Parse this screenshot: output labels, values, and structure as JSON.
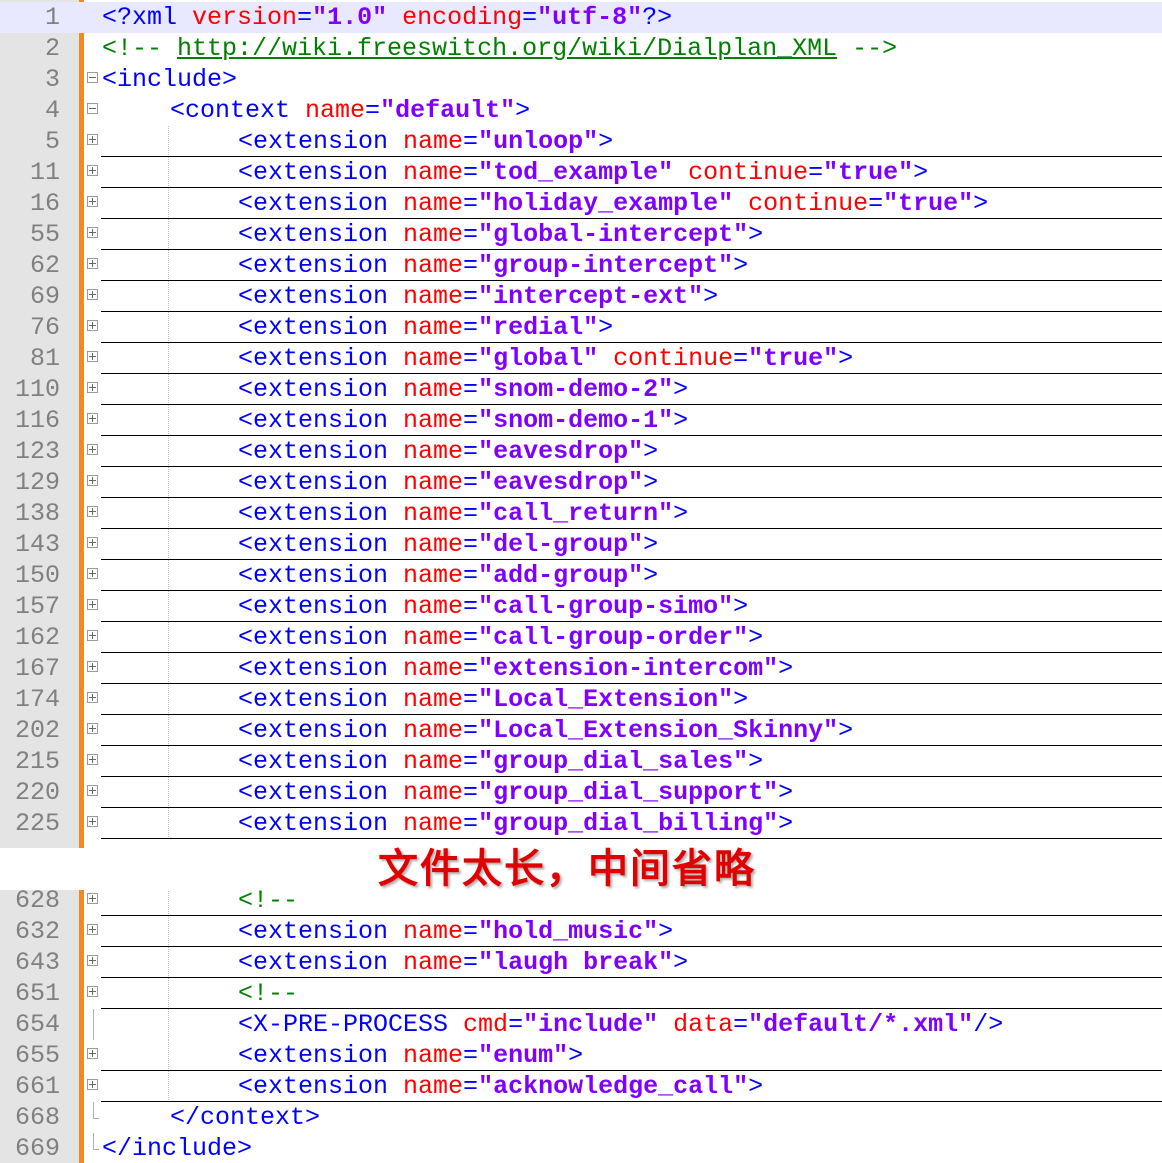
{
  "banner": "文件太长，中间省略",
  "top_lines": [
    {
      "n": "1",
      "fold": "",
      "hl": true,
      "indent": 0,
      "parts": [
        [
          "p",
          "<?"
        ],
        [
          "t",
          "xml "
        ],
        [
          "a",
          "version"
        ],
        [
          "t",
          "="
        ],
        [
          "v",
          "\"1.0\""
        ],
        [
          "a",
          " encoding"
        ],
        [
          "t",
          "="
        ],
        [
          "v",
          "\"utf-8\""
        ],
        [
          "p",
          "?>"
        ]
      ]
    },
    {
      "n": "2",
      "fold": "",
      "indent": 0,
      "parts": [
        [
          "c",
          "<!-- "
        ],
        [
          "u",
          "http://wiki.freeswitch.org/wiki/Dialplan_XML"
        ],
        [
          "c",
          " -->"
        ]
      ]
    },
    {
      "n": "3",
      "fold": "minus",
      "indent": 0,
      "parts": [
        [
          "t",
          "<include>"
        ]
      ]
    },
    {
      "n": "4",
      "fold": "minus",
      "indent": 1,
      "parts": [
        [
          "t",
          "<context "
        ],
        [
          "a",
          "name"
        ],
        [
          "t",
          "="
        ],
        [
          "v",
          "\"default\""
        ],
        [
          "t",
          ">"
        ]
      ]
    },
    {
      "n": "5",
      "fold": "plus",
      "sep": true,
      "indent": 2,
      "parts": [
        [
          "t",
          "<extension "
        ],
        [
          "a",
          "name"
        ],
        [
          "t",
          "="
        ],
        [
          "v",
          "\"unloop\""
        ],
        [
          "t",
          ">"
        ]
      ]
    },
    {
      "n": "11",
      "fold": "plus",
      "sep": true,
      "indent": 2,
      "parts": [
        [
          "t",
          "<extension "
        ],
        [
          "a",
          "name"
        ],
        [
          "t",
          "="
        ],
        [
          "v",
          "\"tod_example\""
        ],
        [
          "a",
          " continue"
        ],
        [
          "t",
          "="
        ],
        [
          "v",
          "\"true\""
        ],
        [
          "t",
          ">"
        ]
      ]
    },
    {
      "n": "16",
      "fold": "plus",
      "sep": true,
      "indent": 2,
      "parts": [
        [
          "t",
          "<extension "
        ],
        [
          "a",
          "name"
        ],
        [
          "t",
          "="
        ],
        [
          "v",
          "\"holiday_example\""
        ],
        [
          "a",
          " continue"
        ],
        [
          "t",
          "="
        ],
        [
          "v",
          "\"true\""
        ],
        [
          "t",
          ">"
        ]
      ]
    },
    {
      "n": "55",
      "fold": "plus",
      "sep": true,
      "indent": 2,
      "parts": [
        [
          "t",
          "<extension "
        ],
        [
          "a",
          "name"
        ],
        [
          "t",
          "="
        ],
        [
          "v",
          "\"global-intercept\""
        ],
        [
          "t",
          ">"
        ]
      ]
    },
    {
      "n": "62",
      "fold": "plus",
      "sep": true,
      "indent": 2,
      "parts": [
        [
          "t",
          "<extension "
        ],
        [
          "a",
          "name"
        ],
        [
          "t",
          "="
        ],
        [
          "v",
          "\"group-intercept\""
        ],
        [
          "t",
          ">"
        ]
      ]
    },
    {
      "n": "69",
      "fold": "plus",
      "sep": true,
      "indent": 2,
      "parts": [
        [
          "t",
          "<extension "
        ],
        [
          "a",
          "name"
        ],
        [
          "t",
          "="
        ],
        [
          "v",
          "\"intercept-ext\""
        ],
        [
          "t",
          ">"
        ]
      ]
    },
    {
      "n": "76",
      "fold": "plus",
      "sep": true,
      "indent": 2,
      "parts": [
        [
          "t",
          "<extension "
        ],
        [
          "a",
          "name"
        ],
        [
          "t",
          "="
        ],
        [
          "v",
          "\"redial\""
        ],
        [
          "t",
          ">"
        ]
      ]
    },
    {
      "n": "81",
      "fold": "plus",
      "sep": true,
      "indent": 2,
      "parts": [
        [
          "t",
          "<extension "
        ],
        [
          "a",
          "name"
        ],
        [
          "t",
          "="
        ],
        [
          "v",
          "\"global\""
        ],
        [
          "a",
          " continue"
        ],
        [
          "t",
          "="
        ],
        [
          "v",
          "\"true\""
        ],
        [
          "t",
          ">"
        ]
      ]
    },
    {
      "n": "110",
      "fold": "plus",
      "sep": true,
      "indent": 2,
      "parts": [
        [
          "t",
          "<extension "
        ],
        [
          "a",
          "name"
        ],
        [
          "t",
          "="
        ],
        [
          "v",
          "\"snom-demo-2\""
        ],
        [
          "t",
          ">"
        ]
      ]
    },
    {
      "n": "116",
      "fold": "plus",
      "sep": true,
      "indent": 2,
      "parts": [
        [
          "t",
          "<extension "
        ],
        [
          "a",
          "name"
        ],
        [
          "t",
          "="
        ],
        [
          "v",
          "\"snom-demo-1\""
        ],
        [
          "t",
          ">"
        ]
      ]
    },
    {
      "n": "123",
      "fold": "plus",
      "sep": true,
      "indent": 2,
      "parts": [
        [
          "t",
          "<extension "
        ],
        [
          "a",
          "name"
        ],
        [
          "t",
          "="
        ],
        [
          "v",
          "\"eavesdrop\""
        ],
        [
          "t",
          ">"
        ]
      ]
    },
    {
      "n": "129",
      "fold": "plus",
      "sep": true,
      "indent": 2,
      "parts": [
        [
          "t",
          "<extension "
        ],
        [
          "a",
          "name"
        ],
        [
          "t",
          "="
        ],
        [
          "v",
          "\"eavesdrop\""
        ],
        [
          "t",
          ">"
        ]
      ]
    },
    {
      "n": "138",
      "fold": "plus",
      "sep": true,
      "indent": 2,
      "parts": [
        [
          "t",
          "<extension "
        ],
        [
          "a",
          "name"
        ],
        [
          "t",
          "="
        ],
        [
          "v",
          "\"call_return\""
        ],
        [
          "t",
          ">"
        ]
      ]
    },
    {
      "n": "143",
      "fold": "plus",
      "sep": true,
      "indent": 2,
      "parts": [
        [
          "t",
          "<extension "
        ],
        [
          "a",
          "name"
        ],
        [
          "t",
          "="
        ],
        [
          "v",
          "\"del-group\""
        ],
        [
          "t",
          ">"
        ]
      ]
    },
    {
      "n": "150",
      "fold": "plus",
      "sep": true,
      "indent": 2,
      "parts": [
        [
          "t",
          "<extension "
        ],
        [
          "a",
          "name"
        ],
        [
          "t",
          "="
        ],
        [
          "v",
          "\"add-group\""
        ],
        [
          "t",
          ">"
        ]
      ]
    },
    {
      "n": "157",
      "fold": "plus",
      "sep": true,
      "indent": 2,
      "parts": [
        [
          "t",
          "<extension "
        ],
        [
          "a",
          "name"
        ],
        [
          "t",
          "="
        ],
        [
          "v",
          "\"call-group-simo\""
        ],
        [
          "t",
          ">"
        ]
      ]
    },
    {
      "n": "162",
      "fold": "plus",
      "sep": true,
      "indent": 2,
      "parts": [
        [
          "t",
          "<extension "
        ],
        [
          "a",
          "name"
        ],
        [
          "t",
          "="
        ],
        [
          "v",
          "\"call-group-order\""
        ],
        [
          "t",
          ">"
        ]
      ]
    },
    {
      "n": "167",
      "fold": "plus",
      "sep": true,
      "indent": 2,
      "parts": [
        [
          "t",
          "<extension "
        ],
        [
          "a",
          "name"
        ],
        [
          "t",
          "="
        ],
        [
          "v",
          "\"extension-intercom\""
        ],
        [
          "t",
          ">"
        ]
      ]
    },
    {
      "n": "174",
      "fold": "plus",
      "sep": true,
      "indent": 2,
      "parts": [
        [
          "t",
          "<extension "
        ],
        [
          "a",
          "name"
        ],
        [
          "t",
          "="
        ],
        [
          "v",
          "\"Local_Extension\""
        ],
        [
          "t",
          ">"
        ]
      ]
    },
    {
      "n": "202",
      "fold": "plus",
      "sep": true,
      "indent": 2,
      "parts": [
        [
          "t",
          "<extension "
        ],
        [
          "a",
          "name"
        ],
        [
          "t",
          "="
        ],
        [
          "v",
          "\"Local_Extension_Skinny\""
        ],
        [
          "t",
          ">"
        ]
      ]
    },
    {
      "n": "215",
      "fold": "plus",
      "sep": true,
      "indent": 2,
      "parts": [
        [
          "t",
          "<extension "
        ],
        [
          "a",
          "name"
        ],
        [
          "t",
          "="
        ],
        [
          "v",
          "\"group_dial_sales\""
        ],
        [
          "t",
          ">"
        ]
      ]
    },
    {
      "n": "220",
      "fold": "plus",
      "sep": true,
      "indent": 2,
      "parts": [
        [
          "t",
          "<extension "
        ],
        [
          "a",
          "name"
        ],
        [
          "t",
          "="
        ],
        [
          "v",
          "\"group_dial_support\""
        ],
        [
          "t",
          ">"
        ]
      ]
    },
    {
      "n": "225",
      "fold": "plus",
      "sep": true,
      "indent": 2,
      "parts": [
        [
          "t",
          "<extension "
        ],
        [
          "a",
          "name"
        ],
        [
          "t",
          "="
        ],
        [
          "v",
          "\"group_dial_billing\""
        ],
        [
          "t",
          ">"
        ]
      ]
    }
  ],
  "bottom_lines": [
    {
      "n": "628",
      "fold": "plus",
      "sep": true,
      "indent": 2,
      "parts": [
        [
          "c",
          "<!--"
        ]
      ]
    },
    {
      "n": "632",
      "fold": "plus",
      "sep": true,
      "indent": 2,
      "parts": [
        [
          "t",
          "<extension "
        ],
        [
          "a",
          "name"
        ],
        [
          "t",
          "="
        ],
        [
          "v",
          "\"hold_music\""
        ],
        [
          "t",
          ">"
        ]
      ]
    },
    {
      "n": "643",
      "fold": "plus",
      "sep": true,
      "indent": 2,
      "parts": [
        [
          "t",
          "<extension "
        ],
        [
          "a",
          "name"
        ],
        [
          "t",
          "="
        ],
        [
          "v",
          "\"laugh break\""
        ],
        [
          "t",
          ">"
        ]
      ]
    },
    {
      "n": "651",
      "fold": "plus",
      "sep": true,
      "indent": 2,
      "parts": [
        [
          "c",
          "<!--"
        ]
      ]
    },
    {
      "n": "654",
      "fold": "",
      "indent": 2,
      "parts": [
        [
          "t",
          "<X-PRE-PROCESS "
        ],
        [
          "a",
          "cmd"
        ],
        [
          "t",
          "="
        ],
        [
          "v",
          "\"include\""
        ],
        [
          "a",
          " data"
        ],
        [
          "t",
          "="
        ],
        [
          "v",
          "\"default/*.xml\""
        ],
        [
          "t",
          "/>"
        ]
      ]
    },
    {
      "n": "655",
      "fold": "plus",
      "sep": true,
      "indent": 2,
      "parts": [
        [
          "t",
          "<extension "
        ],
        [
          "a",
          "name"
        ],
        [
          "t",
          "="
        ],
        [
          "v",
          "\"enum\""
        ],
        [
          "t",
          ">"
        ]
      ]
    },
    {
      "n": "661",
      "fold": "plus",
      "sep": true,
      "indent": 2,
      "parts": [
        [
          "t",
          "<extension "
        ],
        [
          "a",
          "name"
        ],
        [
          "t",
          "="
        ],
        [
          "v",
          "\"acknowledge_call\""
        ],
        [
          "t",
          ">"
        ]
      ]
    },
    {
      "n": "668",
      "fold": "end",
      "indent": 1,
      "parts": [
        [
          "t",
          "</context>"
        ]
      ]
    },
    {
      "n": "669",
      "fold": "end",
      "indent": 0,
      "parts": [
        [
          "t",
          "</include>"
        ]
      ]
    }
  ]
}
